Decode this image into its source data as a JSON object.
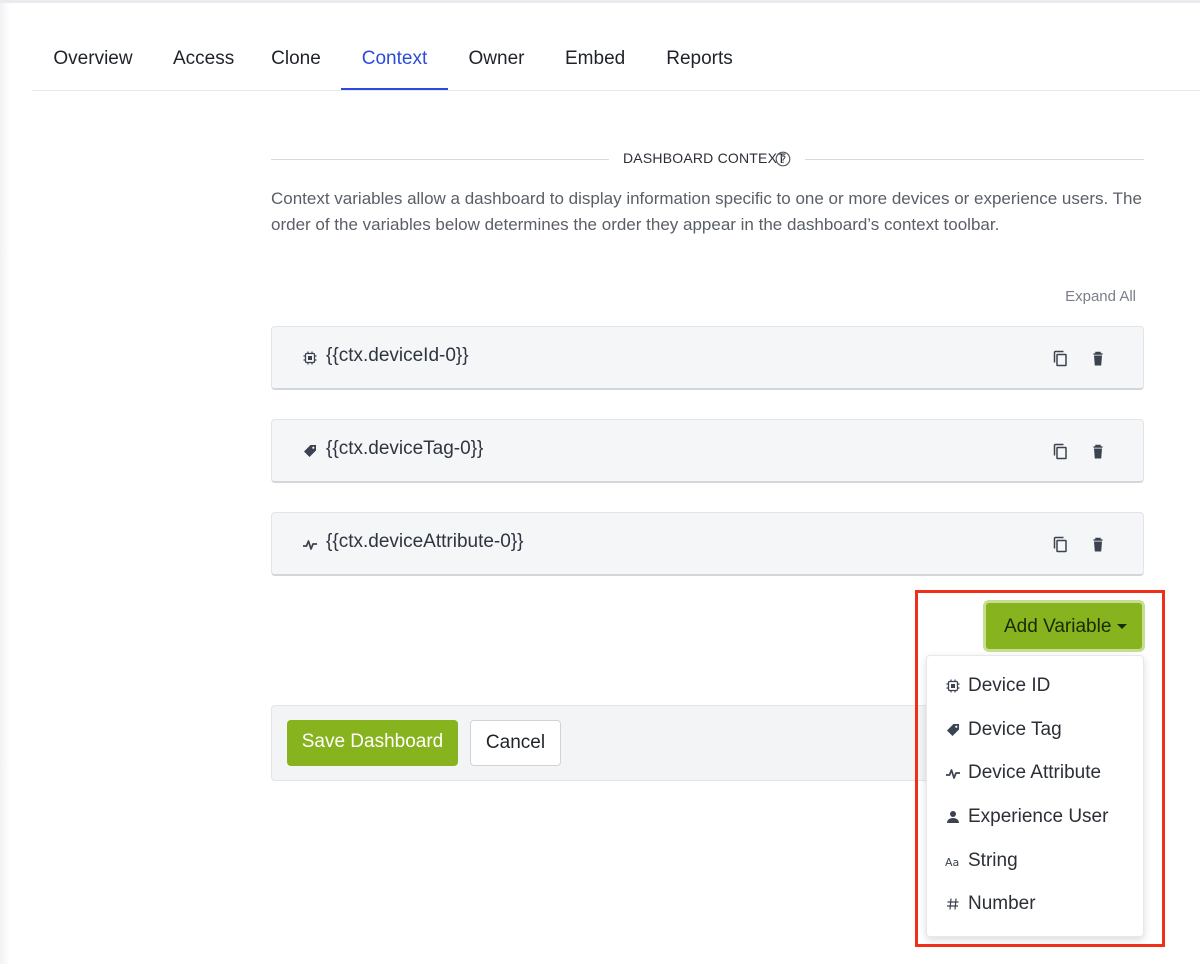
{
  "tabs": [
    {
      "label": "Overview",
      "active": false
    },
    {
      "label": "Access",
      "active": false
    },
    {
      "label": "Clone",
      "active": false
    },
    {
      "label": "Context",
      "active": true
    },
    {
      "label": "Owner",
      "active": false
    },
    {
      "label": "Embed",
      "active": false
    },
    {
      "label": "Reports",
      "active": false
    }
  ],
  "section": {
    "title": "DASHBOARD CONTEXT",
    "help_icon": "question-circle-icon",
    "description": "Context variables allow a dashboard to display information specific to one or more devices or experience users. The order of the variables below determines the order they appear in the dashboard’s context toolbar."
  },
  "expand_all_label": "Expand All",
  "variables": [
    {
      "name": "{{ctx.deviceId-0}}",
      "icon": "chip-icon"
    },
    {
      "name": "{{ctx.deviceTag-0}}",
      "icon": "tag-icon"
    },
    {
      "name": "{{ctx.deviceAttribute-0}}",
      "icon": "pulse-icon"
    }
  ],
  "variable_actions": {
    "copy_icon": "copy-icon",
    "delete_icon": "trash-icon"
  },
  "add_variable": {
    "label": "Add Variable",
    "caret_icon": "caret-down-icon",
    "menu": [
      {
        "label": "Device ID",
        "icon": "chip-icon"
      },
      {
        "label": "Device Tag",
        "icon": "tag-icon"
      },
      {
        "label": "Device Attribute",
        "icon": "pulse-icon"
      },
      {
        "label": "Experience User",
        "icon": "user-icon"
      },
      {
        "label": "String",
        "icon": "text-aa-icon"
      },
      {
        "label": "Number",
        "icon": "hash-icon"
      }
    ]
  },
  "footer": {
    "save_label": "Save Dashboard",
    "cancel_label": "Cancel"
  },
  "colors": {
    "accent": "#86b31e",
    "active_tab": "#2b4cd8",
    "highlight": "#ef2f16"
  }
}
